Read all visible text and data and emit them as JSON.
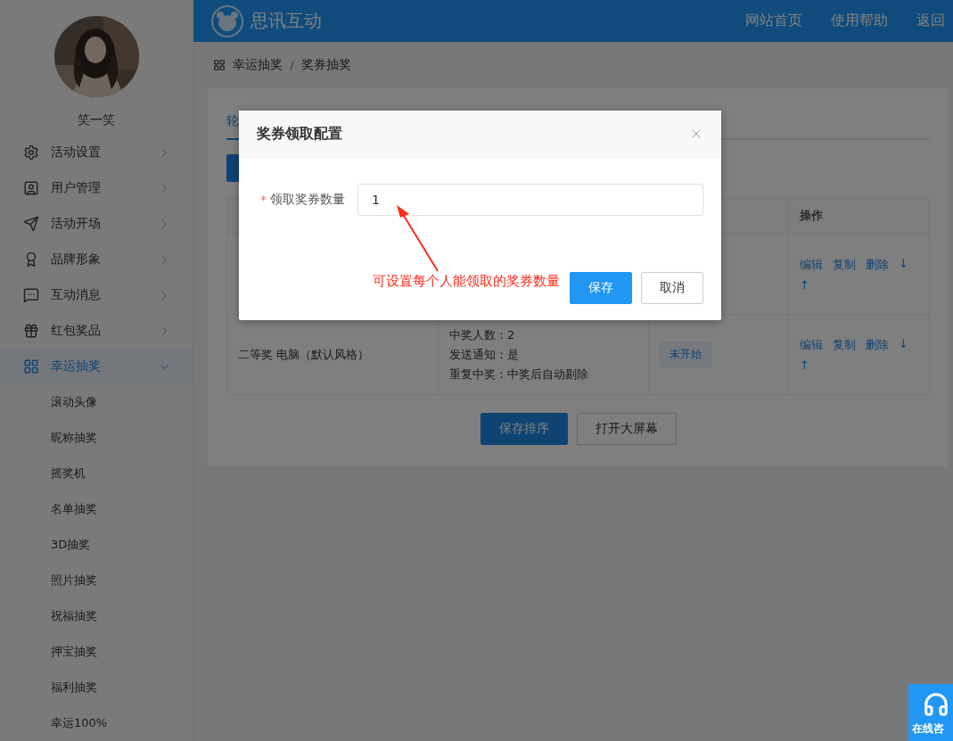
{
  "sidebar": {
    "user_name": "笑一笑",
    "items": [
      {
        "label": "活动设置",
        "selected": false,
        "expanded": false
      },
      {
        "label": "用户管理",
        "selected": false,
        "expanded": false
      },
      {
        "label": "活动开场",
        "selected": false,
        "expanded": false
      },
      {
        "label": "品牌形象",
        "selected": false,
        "expanded": false
      },
      {
        "label": "互动消息",
        "selected": false,
        "expanded": false
      },
      {
        "label": "红包奖品",
        "selected": false,
        "expanded": false
      },
      {
        "label": "幸运抽奖",
        "selected": true,
        "expanded": true,
        "children": [
          {
            "label": "滚动头像"
          },
          {
            "label": "昵称抽奖"
          },
          {
            "label": "摇奖机"
          },
          {
            "label": "名单抽奖"
          },
          {
            "label": "3D抽奖"
          },
          {
            "label": "照片抽奖"
          },
          {
            "label": "祝福抽奖"
          },
          {
            "label": "押宝抽奖"
          },
          {
            "label": "福利抽奖"
          },
          {
            "label": "幸运100%"
          }
        ]
      }
    ]
  },
  "header": {
    "brand": "思讯互动",
    "nav": [
      "网站首页",
      "使用帮助",
      "返回"
    ]
  },
  "breadcrumb": {
    "separator": "/",
    "items": [
      "幸运抽奖",
      "奖券抽奖"
    ]
  },
  "tabs": [
    {
      "label": "轮",
      "selected": true
    }
  ],
  "table": {
    "action_header": "操作",
    "rows": [
      {
        "actions": [
          "编辑",
          "复制",
          "删除",
          "↓",
          "↑"
        ]
      },
      {
        "prize": "二等奖 电脑（默认风格）",
        "details": [
          "中奖人数：2",
          "发送通知：是",
          "重复中奖：中奖后自动剔除"
        ],
        "status": "未开始",
        "actions": [
          "编辑",
          "复制",
          "删除",
          "↓",
          "↑"
        ]
      }
    ]
  },
  "buttons": [
    {
      "label": "保存排序",
      "kind": "primary"
    },
    {
      "label": "打开大屏幕",
      "kind": "default"
    }
  ],
  "dialog": {
    "title": "奖券领取配置",
    "field": {
      "required_mark": "*",
      "label": "领取奖券数量",
      "value": "1"
    },
    "buttons": [
      {
        "label": "保存",
        "kind": "primary"
      },
      {
        "label": "取消",
        "kind": "default"
      }
    ]
  },
  "annotation": "可设置每个人能领取的奖券数量",
  "chat_button": "在线咨"
}
